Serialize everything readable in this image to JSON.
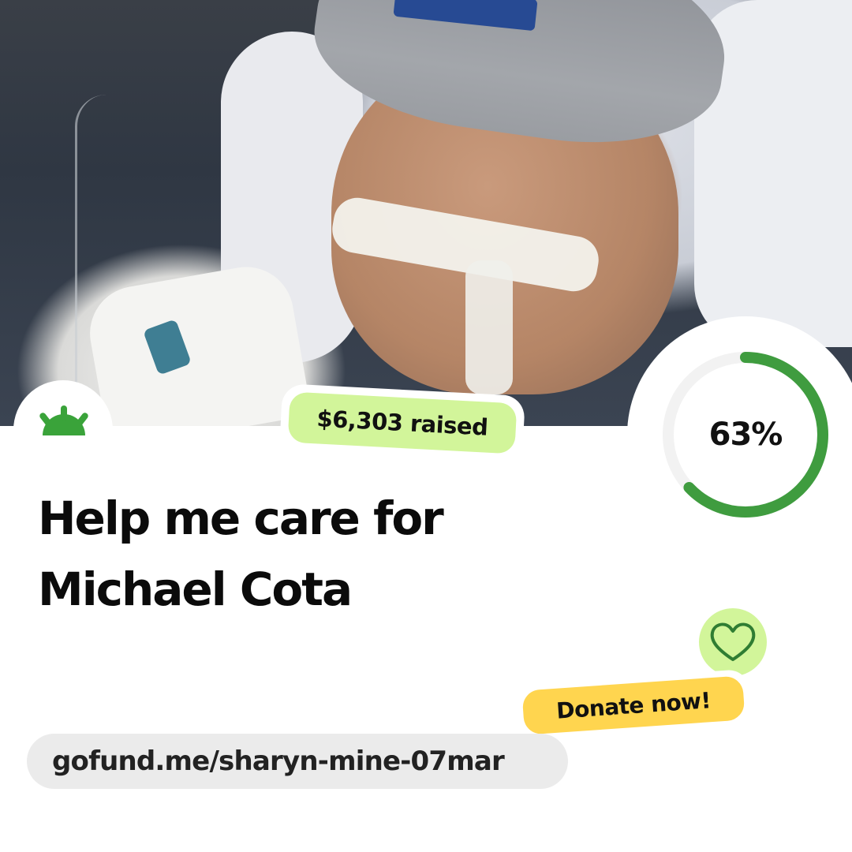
{
  "brand": {
    "logo_icon": "gofundme-sunrise-icon",
    "accent_color": "#3aa33a"
  },
  "campaign": {
    "raised_label": "$6,303 raised",
    "progress_percent": 63,
    "progress_label": "63%",
    "title": "Help me care for Michael Cota",
    "url": "gofund.me/sharyn-mine-07mar"
  },
  "cta": {
    "donate_label": "Donate now!",
    "heart_icon": "heart-icon"
  },
  "colors": {
    "raised_pill": "#d2f59a",
    "heart_circle": "#d2f59a",
    "donate_pill": "#ffd54f",
    "progress_ring": "#3f9c3f",
    "progress_track": "#f2f2f2",
    "url_pill": "#ebebeb"
  }
}
